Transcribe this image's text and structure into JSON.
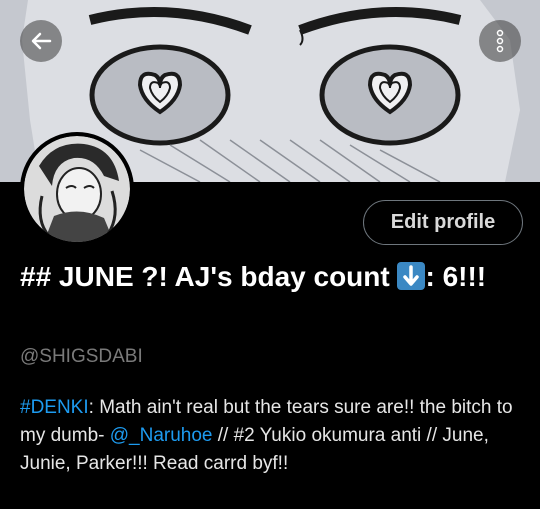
{
  "header": {
    "back_icon": "arrow-left-icon",
    "more_icon": "more-vertical-icon"
  },
  "profile": {
    "edit_button_label": "Edit profile",
    "display_name_part1": "## JUNE ?! AJ's bday count ",
    "display_name_emoji": "down-arrow-emoji",
    "display_name_part2": ": 6!!!",
    "handle": "@SHIGSDABI",
    "bio": {
      "hashtag": "#DENKI",
      "text1": ": Math ain't real but the tears sure are!! the bitch to my dumb- ",
      "mention": "@_Naruhoe",
      "text2": " // #2 Yukio okumura anti // June, Junie, Parker!!! Read carrd byf!!"
    }
  },
  "colors": {
    "background": "#000000",
    "link": "#1d9bf0",
    "handle": "#7a7a7a",
    "button_border": "#6e767d"
  }
}
